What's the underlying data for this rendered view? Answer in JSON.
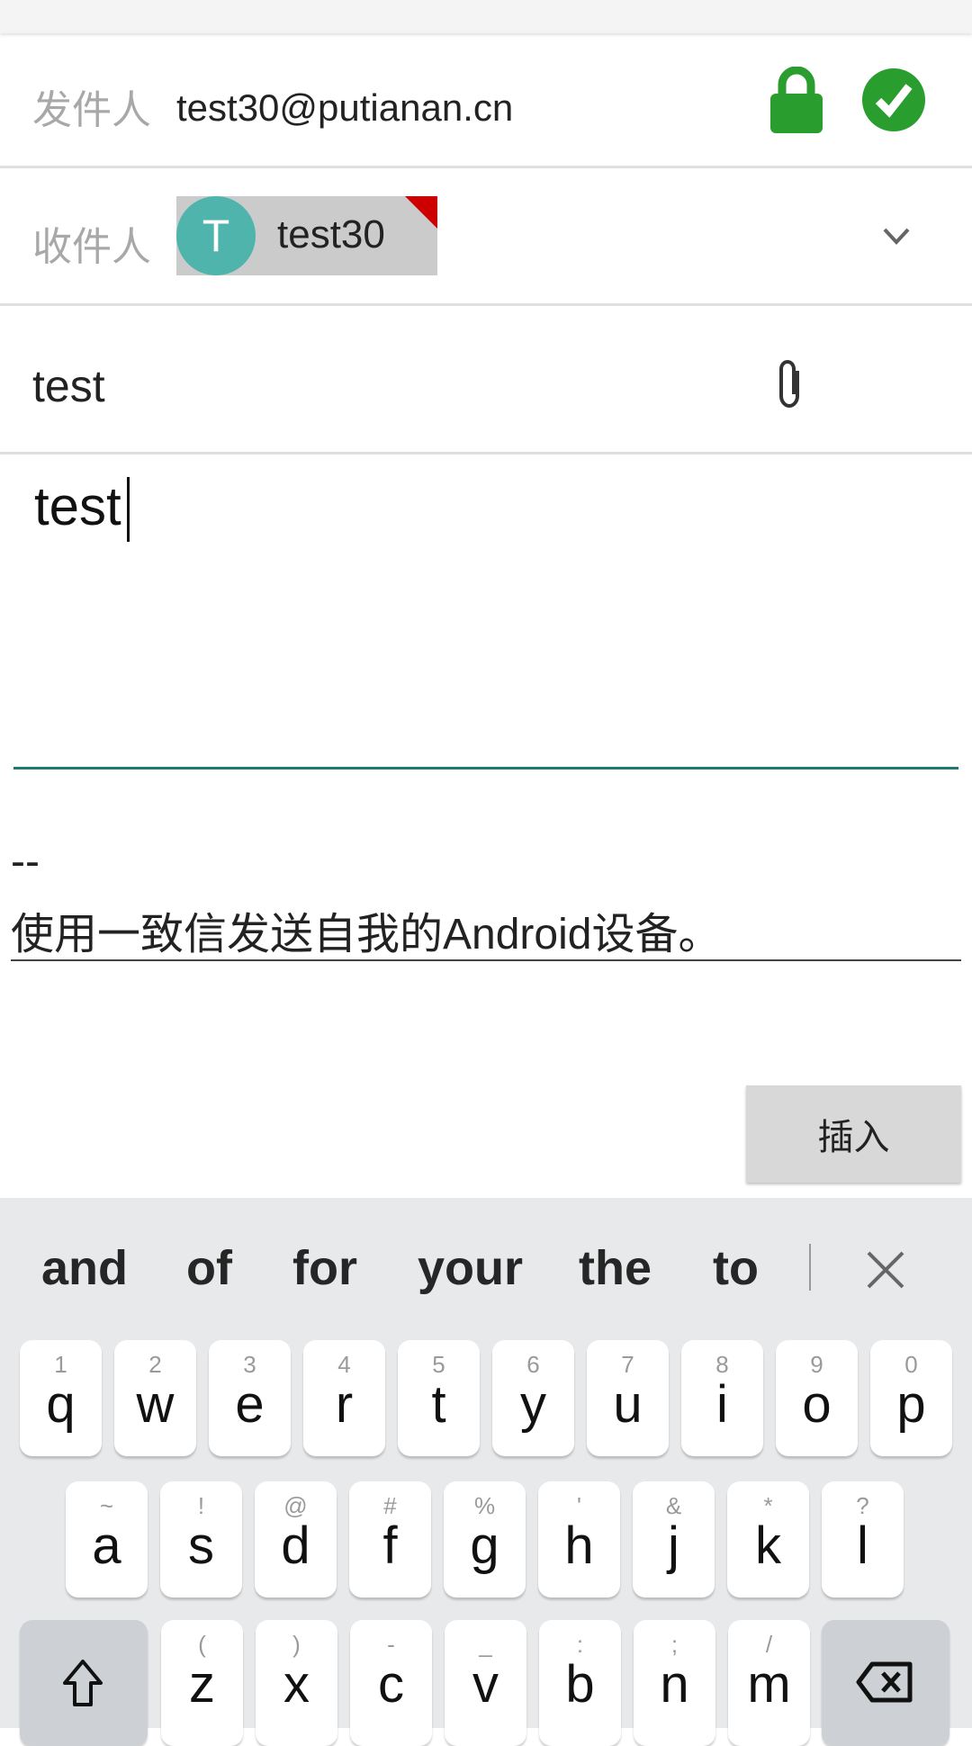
{
  "from": {
    "label": "发件人",
    "value": "test30@putianan.cn",
    "lock_icon": "lock-icon",
    "verified_icon": "check-circle-icon",
    "accent": "#2a9d2f"
  },
  "to": {
    "label": "收件人",
    "chip_initial": "T",
    "chip_name": "test30",
    "chip_color": "#4fb5ac",
    "warning_color": "#cc0000"
  },
  "subject": {
    "value": "test"
  },
  "body": {
    "value": "test"
  },
  "signature": {
    "separator": "--",
    "text": "使用一致信发送自我的Android设备。"
  },
  "insert_button": "插入",
  "keyboard": {
    "suggestions": [
      "and",
      "of",
      "for",
      "your",
      "the",
      "to"
    ],
    "row1": [
      {
        "k": "q",
        "h": "1"
      },
      {
        "k": "w",
        "h": "2"
      },
      {
        "k": "e",
        "h": "3"
      },
      {
        "k": "r",
        "h": "4"
      },
      {
        "k": "t",
        "h": "5"
      },
      {
        "k": "y",
        "h": "6"
      },
      {
        "k": "u",
        "h": "7"
      },
      {
        "k": "i",
        "h": "8"
      },
      {
        "k": "o",
        "h": "9"
      },
      {
        "k": "p",
        "h": "0"
      }
    ],
    "row2": [
      {
        "k": "a",
        "h": "~"
      },
      {
        "k": "s",
        "h": "!"
      },
      {
        "k": "d",
        "h": "@"
      },
      {
        "k": "f",
        "h": "#"
      },
      {
        "k": "g",
        "h": "%"
      },
      {
        "k": "h",
        "h": "'"
      },
      {
        "k": "j",
        "h": "&"
      },
      {
        "k": "k",
        "h": "*"
      },
      {
        "k": "l",
        "h": "?"
      }
    ],
    "row3": [
      {
        "k": "z",
        "h": "("
      },
      {
        "k": "x",
        "h": ")"
      },
      {
        "k": "c",
        "h": "-"
      },
      {
        "k": "v",
        "h": "_"
      },
      {
        "k": "b",
        "h": ":"
      },
      {
        "k": "n",
        "h": ";"
      },
      {
        "k": "m",
        "h": "/"
      }
    ]
  }
}
